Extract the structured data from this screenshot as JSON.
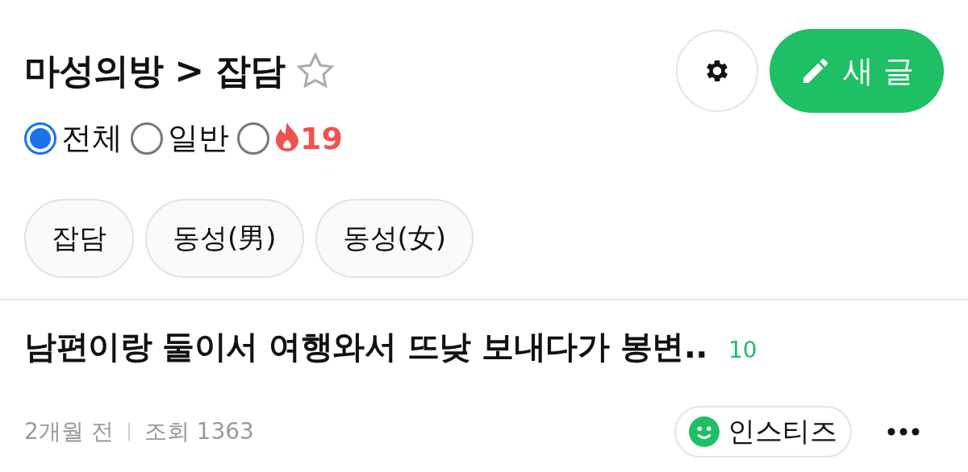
{
  "header": {
    "board": "마성의방",
    "separator": ">",
    "category": "잡담",
    "favorite": false
  },
  "filters": [
    {
      "label": "전체",
      "kind": "text",
      "selected": true
    },
    {
      "label": "일반",
      "kind": "text",
      "selected": false
    },
    {
      "label": "19",
      "kind": "adult",
      "selected": false
    }
  ],
  "new_post_button": "새 글",
  "chips": [
    "잡담",
    "동성(男)",
    "동성(女)"
  ],
  "posts": [
    {
      "title": "남편이랑 둘이서 여행와서 뜨낮 보내다가 봉변..",
      "comments": "10",
      "time": "2개월 전",
      "views": "조회 1363",
      "author": "인스티즈"
    }
  ]
}
